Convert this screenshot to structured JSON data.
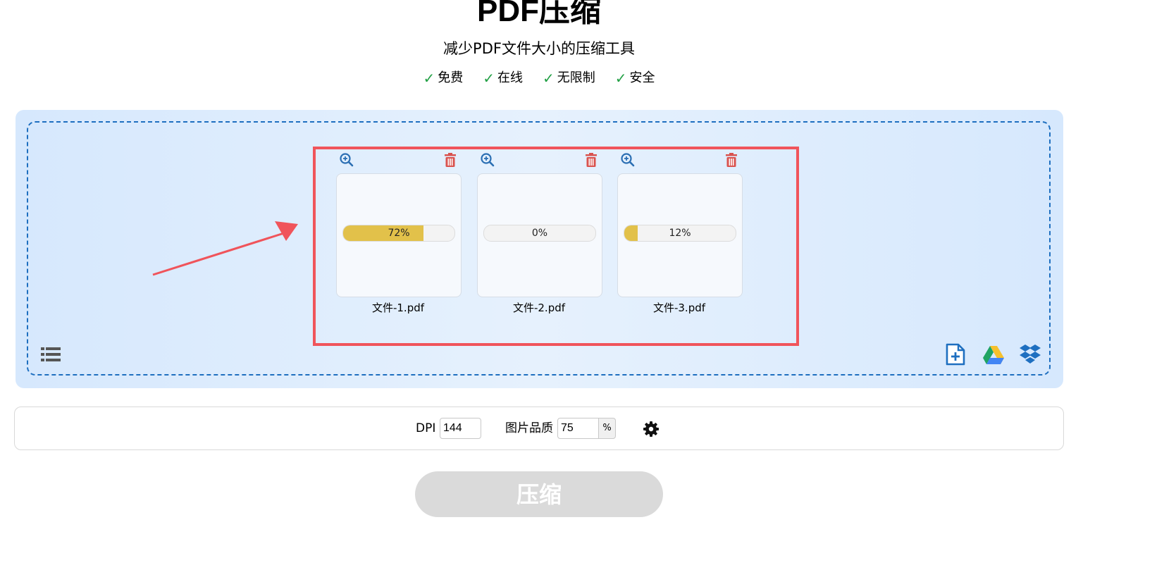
{
  "header": {
    "title": "PDF压缩",
    "subtitle": "减少PDF文件大小的压缩工具",
    "features": [
      {
        "check": "✓",
        "label": "免费"
      },
      {
        "check": "✓",
        "label": "在线"
      },
      {
        "check": "✓",
        "label": "无限制"
      },
      {
        "check": "✓",
        "label": "安全"
      }
    ]
  },
  "files": [
    {
      "name": "文件-1.pdf",
      "progress_text": "72%",
      "progress": 0.72,
      "zoom_icon": "zoom-in-icon",
      "delete_icon": "trash-icon"
    },
    {
      "name": "文件-2.pdf",
      "progress_text": "0%",
      "progress": 0.0,
      "zoom_icon": "zoom-in-icon",
      "delete_icon": "trash-icon"
    },
    {
      "name": "文件-3.pdf",
      "progress_text": "12%",
      "progress": 0.12,
      "zoom_icon": "zoom-in-icon",
      "delete_icon": "trash-icon"
    }
  ],
  "dropzone_icons": {
    "list": "list-icon",
    "add_file": "add-file-icon",
    "google_drive": "google-drive-icon",
    "dropbox": "dropbox-icon"
  },
  "options": {
    "dpi_label": "DPI",
    "dpi_value": "144",
    "quality_label": "图片品质",
    "quality_value": "75",
    "quality_unit": "%",
    "settings_icon": "gear-icon"
  },
  "compress_button": "压缩",
  "colors": {
    "accent_blue": "#1e6fc0",
    "check_green": "#22a045",
    "progress_fill": "#e2c14a",
    "highlight_red": "#f0545b",
    "delete_red": "#d9534f",
    "button_disabled": "#dadada"
  }
}
